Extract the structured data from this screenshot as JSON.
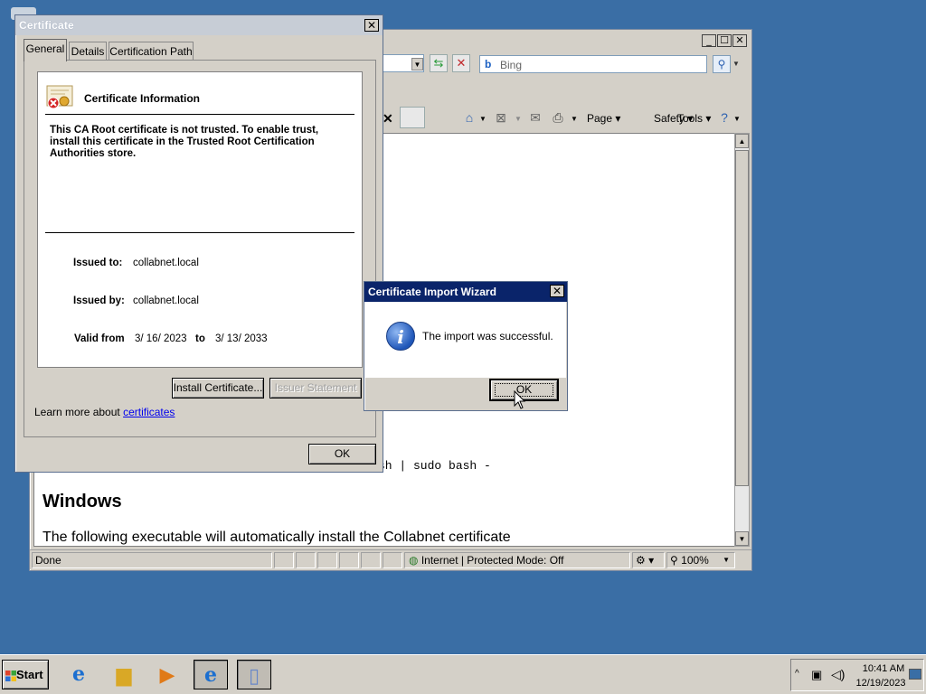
{
  "ie_window": {
    "search_placeholder": "Bing",
    "command_bar": {
      "page": "Page",
      "safety": "Safety",
      "tools": "Tools"
    },
    "content": {
      "code_line": "sh | sudo bash -",
      "heading": "Windows",
      "paragraph": "The following executable will automatically install the Collabnet certificate"
    },
    "status_bar": {
      "status": "Done",
      "zone": "Internet | Protected Mode: Off",
      "zoom": "100%"
    }
  },
  "certificate_dialog": {
    "title": "Certificate",
    "tabs": [
      "General",
      "Details",
      "Certification Path"
    ],
    "info_title": "Certificate Information",
    "warning": "This CA Root certificate is not trusted. To enable trust, install this certificate in the Trusted Root Certification Authorities store.",
    "issued_to_label": "Issued to:",
    "issued_to": "collabnet.local",
    "issued_by_label": "Issued by:",
    "issued_by": "collabnet.local",
    "valid_from_label": "Valid from",
    "valid_from": "3/ 16/ 2023",
    "valid_to_label": "to",
    "valid_to": "3/ 13/ 2033",
    "install_button": "Install Certificate...",
    "issuer_button": "Issuer Statement",
    "learn_more": "Learn more about",
    "learn_more_link": "certificates",
    "ok_button": "OK"
  },
  "import_wizard": {
    "title": "Certificate Import Wizard",
    "message": "The import was successful.",
    "ok_button": "OK"
  },
  "taskbar": {
    "start": "Start",
    "time": "10:41 AM",
    "date": "12/19/2023"
  }
}
